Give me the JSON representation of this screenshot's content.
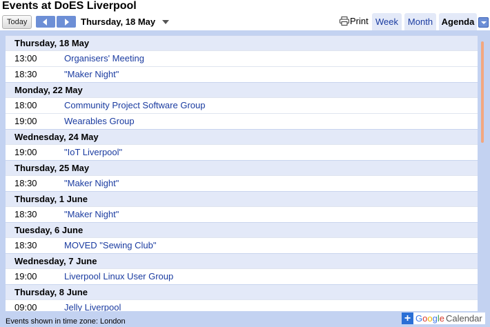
{
  "title": "Events at DoES Liverpool",
  "toolbar": {
    "today_label": "Today",
    "date_label": "Thursday, 18 May",
    "print_label": "Print",
    "tabs": [
      {
        "label": "Week"
      },
      {
        "label": "Month"
      },
      {
        "label": "Agenda"
      }
    ]
  },
  "days": [
    {
      "label": "Thursday, 18 May",
      "events": [
        {
          "time": "13:00",
          "title": "Organisers' Meeting"
        },
        {
          "time": "18:30",
          "title": "\"Maker Night\""
        }
      ]
    },
    {
      "label": "Monday, 22 May",
      "events": [
        {
          "time": "18:00",
          "title": "Community Project Software Group"
        },
        {
          "time": "19:00",
          "title": "Wearables Group"
        }
      ]
    },
    {
      "label": "Wednesday, 24 May",
      "events": [
        {
          "time": "19:00",
          "title": "\"IoT Liverpool\""
        }
      ]
    },
    {
      "label": "Thursday, 25 May",
      "events": [
        {
          "time": "18:30",
          "title": "\"Maker Night\""
        }
      ]
    },
    {
      "label": "Thursday, 1 June",
      "events": [
        {
          "time": "18:30",
          "title": "\"Maker Night\""
        }
      ]
    },
    {
      "label": "Tuesday, 6 June",
      "events": [
        {
          "time": "18:30",
          "title": "MOVED \"Sewing Club\""
        }
      ]
    },
    {
      "label": "Wednesday, 7 June",
      "events": [
        {
          "time": "19:00",
          "title": "Liverpool Linux User Group"
        }
      ]
    },
    {
      "label": "Thursday, 8 June",
      "events": [
        {
          "time": "09:00",
          "title": "Jelly Liverpool"
        }
      ]
    }
  ],
  "footer": {
    "timezone_text": "Events shown in time zone: London",
    "google_calendar": {
      "g1": "G",
      "g2": "o",
      "g3": "o",
      "g4": "g",
      "g5": "l",
      "g6": "e",
      "calendar": "Calendar",
      "plus": "+"
    }
  },
  "colors": {
    "accent": "#6d8fd6",
    "link": "#1a3ba0",
    "panel": "#c3d2f1",
    "day_header": "#e3e9f8"
  }
}
